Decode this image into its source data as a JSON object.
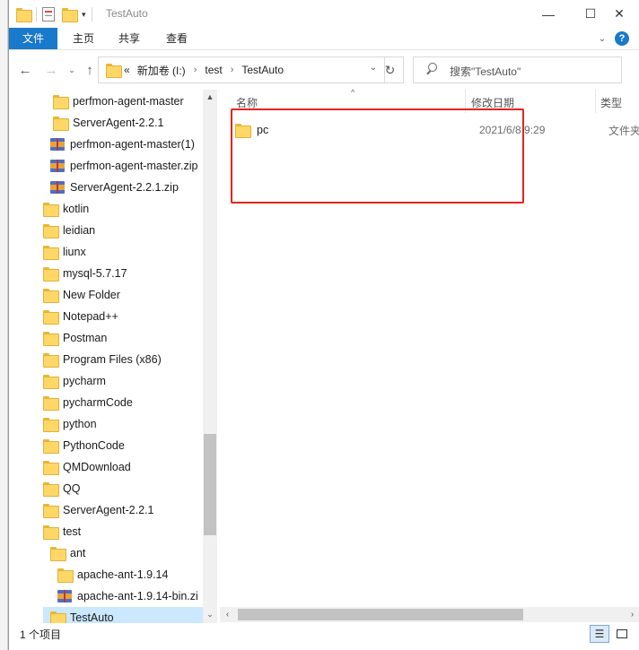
{
  "window": {
    "title": "TestAuto",
    "controls": {
      "minimize": "—",
      "maximize": "☐",
      "close": "✕"
    }
  },
  "ribbon": {
    "tabs": [
      "文件",
      "主页",
      "共享",
      "查看"
    ],
    "help": "?"
  },
  "address": {
    "overflow": "«",
    "crumbs": [
      "新加卷 (I:)",
      "test",
      "TestAuto"
    ],
    "search_placeholder": "搜索\"TestAuto\""
  },
  "tree": [
    {
      "label": "perfmon-agent-master",
      "icon": "folder"
    },
    {
      "label": "ServerAgent-2.2.1",
      "icon": "folder"
    },
    {
      "label": "perfmon-agent-master(1)",
      "icon": "zip"
    },
    {
      "label": "perfmon-agent-master.zip",
      "icon": "zip"
    },
    {
      "label": "ServerAgent-2.2.1.zip",
      "icon": "zip"
    },
    {
      "label": "kotlin",
      "icon": "folder"
    },
    {
      "label": "leidian",
      "icon": "folder"
    },
    {
      "label": "liunx",
      "icon": "folder"
    },
    {
      "label": "mysql-5.7.17",
      "icon": "folder"
    },
    {
      "label": "New Folder",
      "icon": "folder"
    },
    {
      "label": "Notepad++",
      "icon": "folder"
    },
    {
      "label": "Postman",
      "icon": "folder"
    },
    {
      "label": "Program Files (x86)",
      "icon": "folder"
    },
    {
      "label": "pycharm",
      "icon": "folder"
    },
    {
      "label": "pycharmCode",
      "icon": "folder"
    },
    {
      "label": "python",
      "icon": "folder"
    },
    {
      "label": "PythonCode",
      "icon": "folder"
    },
    {
      "label": "QMDownload",
      "icon": "folder"
    },
    {
      "label": "QQ",
      "icon": "folder"
    },
    {
      "label": "ServerAgent-2.2.1",
      "icon": "folder"
    },
    {
      "label": "test",
      "icon": "folder"
    },
    {
      "label": "ant",
      "icon": "folder"
    },
    {
      "label": "apache-ant-1.9.14",
      "icon": "folder"
    },
    {
      "label": "apache-ant-1.9.14-bin.zi",
      "icon": "zip"
    },
    {
      "label": "TestAuto",
      "icon": "folder",
      "selected": true
    }
  ],
  "columns": {
    "name": "名称",
    "date": "修改日期",
    "type": "类型"
  },
  "files": [
    {
      "name": "pc",
      "date": "2021/6/8 9:29",
      "type": "文件夹"
    }
  ],
  "status": {
    "count": "1 个项目"
  },
  "colors": {
    "accent": "#1979ca",
    "selection": "#cce8ff",
    "annotation": "#e8231f",
    "folder": "#ffd767"
  }
}
